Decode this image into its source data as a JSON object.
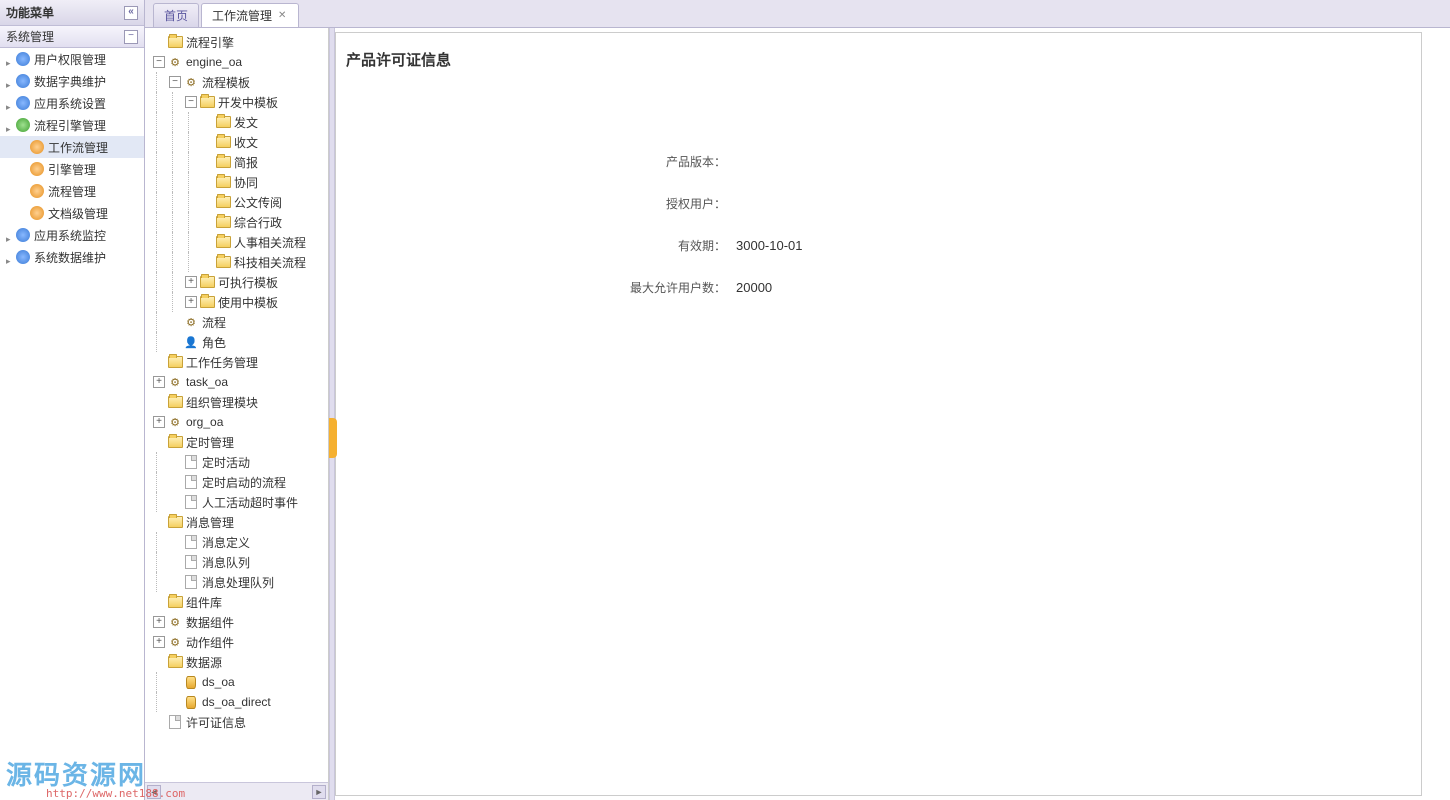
{
  "sidebar": {
    "title": "功能菜单",
    "section": "系统管理",
    "items": [
      {
        "label": "用户权限管理",
        "icon": "blue"
      },
      {
        "label": "数据字典维护",
        "icon": "blue"
      },
      {
        "label": "应用系统设置",
        "icon": "blue"
      },
      {
        "label": "流程引擎管理",
        "icon": "green",
        "expanded": true,
        "children": [
          {
            "label": "工作流管理",
            "icon": "orange",
            "active": true
          },
          {
            "label": "引擎管理",
            "icon": "orange"
          },
          {
            "label": "流程管理",
            "icon": "orange"
          },
          {
            "label": "文档级管理",
            "icon": "orange"
          }
        ]
      },
      {
        "label": "应用系统监控",
        "icon": "blue"
      },
      {
        "label": "系统数据维护",
        "icon": "blue"
      }
    ]
  },
  "tabs": [
    {
      "label": "首页",
      "closable": false,
      "active": false
    },
    {
      "label": "工作流管理",
      "closable": true,
      "active": true
    }
  ],
  "tree": [
    {
      "d": 0,
      "t": "folder",
      "tg": "",
      "label": "流程引擎"
    },
    {
      "d": 0,
      "t": "gear",
      "tg": "-",
      "label": "engine_oa"
    },
    {
      "d": 1,
      "t": "gear",
      "tg": "-",
      "label": "流程模板"
    },
    {
      "d": 2,
      "t": "folder",
      "tg": "-",
      "label": "开发中模板"
    },
    {
      "d": 3,
      "t": "folder",
      "tg": "",
      "label": "发文"
    },
    {
      "d": 3,
      "t": "folder",
      "tg": "",
      "label": "收文"
    },
    {
      "d": 3,
      "t": "folder",
      "tg": "",
      "label": "简报"
    },
    {
      "d": 3,
      "t": "folder",
      "tg": "",
      "label": "协同"
    },
    {
      "d": 3,
      "t": "folder",
      "tg": "",
      "label": "公文传阅"
    },
    {
      "d": 3,
      "t": "folder",
      "tg": "",
      "label": "综合行政"
    },
    {
      "d": 3,
      "t": "folder",
      "tg": "",
      "label": "人事相关流程"
    },
    {
      "d": 3,
      "t": "folder",
      "tg": "",
      "label": "科技相关流程"
    },
    {
      "d": 2,
      "t": "folder",
      "tg": "+",
      "label": "可执行模板"
    },
    {
      "d": 2,
      "t": "folder",
      "tg": "+",
      "label": "使用中模板"
    },
    {
      "d": 1,
      "t": "gear",
      "tg": "",
      "label": "流程"
    },
    {
      "d": 1,
      "t": "usr",
      "tg": "",
      "label": "角色"
    },
    {
      "d": 0,
      "t": "folder",
      "tg": "",
      "label": "工作任务管理"
    },
    {
      "d": 0,
      "t": "gear",
      "tg": "+",
      "label": "task_oa"
    },
    {
      "d": 0,
      "t": "folder",
      "tg": "",
      "label": "组织管理模块"
    },
    {
      "d": 0,
      "t": "gear",
      "tg": "+",
      "label": "org_oa"
    },
    {
      "d": 0,
      "t": "folder",
      "tg": "",
      "label": "定时管理"
    },
    {
      "d": 1,
      "t": "file",
      "tg": "",
      "label": "定时活动"
    },
    {
      "d": 1,
      "t": "file",
      "tg": "",
      "label": "定时启动的流程"
    },
    {
      "d": 1,
      "t": "file",
      "tg": "",
      "label": "人工活动超时事件"
    },
    {
      "d": 0,
      "t": "folder",
      "tg": "",
      "label": "消息管理"
    },
    {
      "d": 1,
      "t": "file",
      "tg": "",
      "label": "消息定义"
    },
    {
      "d": 1,
      "t": "file",
      "tg": "",
      "label": "消息队列"
    },
    {
      "d": 1,
      "t": "file",
      "tg": "",
      "label": "消息处理队列"
    },
    {
      "d": 0,
      "t": "folder",
      "tg": "",
      "label": "组件库"
    },
    {
      "d": 0,
      "t": "gear",
      "tg": "+",
      "label": "数据组件"
    },
    {
      "d": 0,
      "t": "gear",
      "tg": "+",
      "label": "动作组件"
    },
    {
      "d": 0,
      "t": "folder",
      "tg": "",
      "label": "数据源"
    },
    {
      "d": 1,
      "t": "db",
      "tg": "",
      "label": "ds_oa"
    },
    {
      "d": 1,
      "t": "db",
      "tg": "",
      "label": "ds_oa_direct"
    },
    {
      "d": 0,
      "t": "file",
      "tg": "",
      "label": "许可证信息"
    }
  ],
  "content": {
    "title": "产品许可证信息",
    "rows": [
      {
        "label": "产品版本：",
        "value": ""
      },
      {
        "label": "授权用户：",
        "value": ""
      },
      {
        "label": "有效期：",
        "value": "3000-10-01"
      },
      {
        "label": "最大允许用户数：",
        "value": "20000"
      }
    ]
  },
  "watermark": {
    "text": "源码资源网",
    "url": "http://www.net188.com"
  }
}
